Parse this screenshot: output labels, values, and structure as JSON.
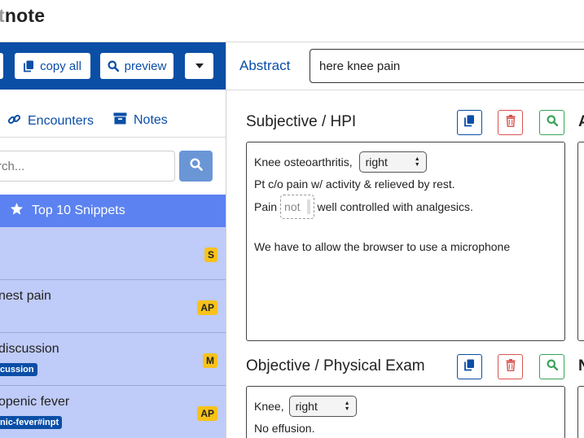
{
  "app": {
    "logo_dim": "t",
    "logo_main": "note"
  },
  "toolbar": {
    "copy_all": "copy all",
    "preview": "preview"
  },
  "sidebar": {
    "tabs": [
      {
        "label": "Encounters",
        "icon": "link-icon"
      },
      {
        "label": "Notes",
        "icon": "archive-icon"
      }
    ],
    "search": {
      "placeholder": "rch...",
      "icon": "search-icon"
    },
    "top10": "Top 10 Snippets",
    "snippets": [
      {
        "title": "",
        "tag": "",
        "badge": "S"
      },
      {
        "title": "nest pain",
        "tag": "",
        "badge": "AP"
      },
      {
        "title": "discussion",
        "tag": "cussion",
        "badge": "M"
      },
      {
        "title": "openic fever",
        "tag": "nic-fever#inpt",
        "badge": "AP"
      }
    ]
  },
  "abstract": {
    "label": "Abstract",
    "value": "here knee pain"
  },
  "sections": {
    "subjective": {
      "title": "Subjective / HPI",
      "line1_prefix": "Knee osteoarthritis,",
      "line1_select": "right",
      "line2": "Pt c/o pain w/ activity & relieved by rest.",
      "line3_prefix": "Pain",
      "line3_placeholder": "not",
      "line3_suffix": "well controlled with analgesics.",
      "line4": "We have to allow the browser to use a microphone"
    },
    "objective": {
      "title": "Objective / Physical Exam",
      "line1_prefix": "Knee,",
      "line1_select": "right",
      "line2": "No effusion."
    }
  },
  "peek": {
    "right_top": "A",
    "right_bottom": "N"
  },
  "colors": {
    "primary": "#0a4ea6",
    "snippet_bg": "#bfcbf8",
    "top10_bg": "#5b82f0",
    "badge": "#f7c21a"
  }
}
